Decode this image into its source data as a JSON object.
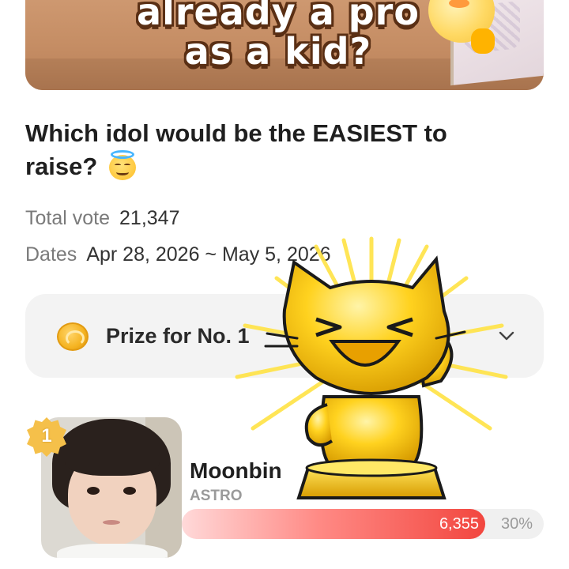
{
  "banner": {
    "title_line1": "already a pro",
    "title_line2": "as a kid?"
  },
  "poll": {
    "question": "Which idol would be the EASIEST to raise?",
    "question_emoji": "smiling-face-with-halo",
    "total_vote_label": "Total vote",
    "total_vote_value": "21,347",
    "dates_label": "Dates",
    "dates_value": "Apr 28, 2026 ~ May 5, 2026"
  },
  "prize": {
    "label": "Prize for No. 1",
    "icon": "coin-icon",
    "chevron_icon": "chevron-down-icon"
  },
  "candidates": [
    {
      "rank": "1",
      "name": "Moonbin",
      "group": "ASTRO",
      "votes": "6,355",
      "percent": "30%",
      "share": 0.3
    }
  ],
  "sticker": {
    "icon": "golden-cat-trophy-sticker"
  },
  "colors": {
    "bar_start": "#ffd9d9",
    "bar_end": "#f2463f",
    "prize_box": "#f3f3f3",
    "badge_gold": "#f5c04a",
    "sticker_gold": "#ffd21f"
  }
}
